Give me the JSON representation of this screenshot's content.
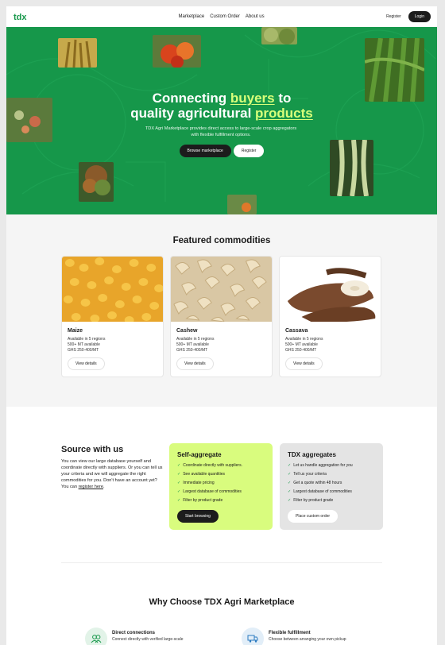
{
  "header": {
    "logo_text": "tdx",
    "nav": [
      "Marketplace",
      "Custom Order",
      "About us"
    ],
    "register_label": "Register",
    "login_label": "Login"
  },
  "hero": {
    "title_pre": "Connecting ",
    "title_hl1": "buyers",
    "title_mid": " to",
    "title_line2_pre": "quality agricultural ",
    "title_hl2": "products",
    "subtitle": "TDX Agri Marketplace provides direct access to large-scale crop aggregators with flexible fulfillment options.",
    "browse_label": "Browse marketplace",
    "register_label": "Register"
  },
  "featured": {
    "title": "Featured commodities",
    "items": [
      {
        "name": "Maize",
        "regions": "Available in 5 regions",
        "qty": "500+ MT available",
        "price": "GHS 250-400/MT",
        "button": "View details"
      },
      {
        "name": "Cashew",
        "regions": "Available in 5 regions",
        "qty": "500+ MT available",
        "price": "GHS 250-400/MT",
        "button": "View details"
      },
      {
        "name": "Cassava",
        "regions": "Available in 5 regions",
        "qty": "500+ MT available",
        "price": "GHS 250-400/MT",
        "button": "View details"
      }
    ]
  },
  "source": {
    "title": "Source with us",
    "body": "You can view our large database yourself and coordinate directly with suppliers. Or you can tell us your criteria and we will aggregate the right commodities for you. Don't have an account yet? You can",
    "link": "register here",
    "link_suffix": ".",
    "self": {
      "title": "Self-aggregate",
      "items": [
        "Coordinate directly with suppliers.",
        "See available quantities",
        "Immediate pricing",
        "Largest database of commodities",
        "Filter by product grade"
      ],
      "button": "Start browsing"
    },
    "tdx": {
      "title": "TDX aggregates",
      "items": [
        "Let us handle aggregation for you",
        "Tell us your criteria",
        "Get a quote within 48 hours",
        "Largest database of commodities",
        "Filter by product grade"
      ],
      "button": "Place custom order"
    }
  },
  "why": {
    "title": "Why Choose TDX Agri Marketplace",
    "features": [
      {
        "title": "Direct connections",
        "desc": "Connect directly with verified large-scale"
      },
      {
        "title": "Flexible fulfillment",
        "desc": "Choose between arranging your own pickup"
      }
    ]
  },
  "colors": {
    "brand_green": "#16974a",
    "accent_lime": "#d9fc7e",
    "dark": "#1c1c1c"
  }
}
